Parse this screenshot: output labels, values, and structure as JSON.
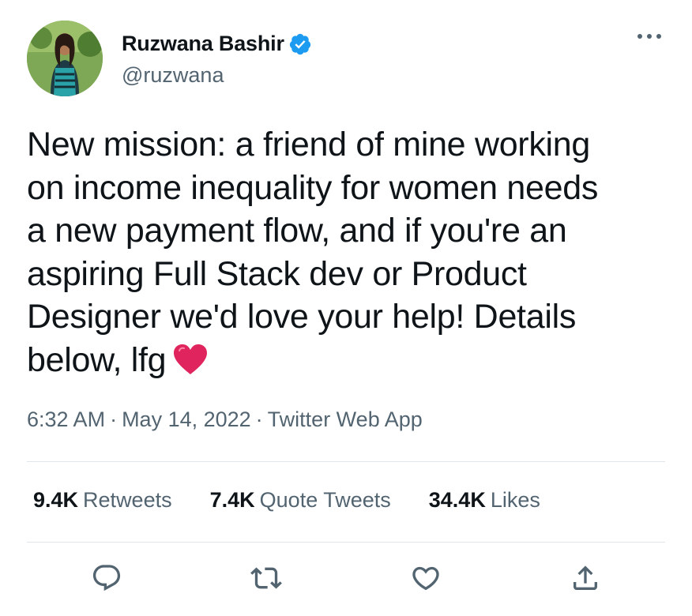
{
  "author": {
    "display_name": "Ruzwana Bashir",
    "handle": "@ruzwana",
    "verified": true
  },
  "tweet": {
    "text": "New mission: a friend of mine working\non income inequality for women needs\na new payment flow, and if you're an\naspiring Full Stack dev or Product\nDesigner we'd love your help! Details\nbelow, lfg",
    "emoji": "red-heart"
  },
  "meta": {
    "time": "6:32 AM",
    "separator": "·",
    "date": "May 14, 2022",
    "source": "Twitter Web App"
  },
  "stats": {
    "retweets": {
      "count": "9.4K",
      "label": "Retweets"
    },
    "quote_tweets": {
      "count": "7.4K",
      "label": "Quote Tweets"
    },
    "likes": {
      "count": "34.4K",
      "label": "Likes"
    }
  },
  "icons": {
    "more": "more-icon",
    "verified": "verified-badge-icon",
    "reply": "reply-icon",
    "retweet": "retweet-icon",
    "like": "like-icon",
    "share": "share-icon"
  },
  "colors": {
    "text_primary": "#0f1419",
    "text_secondary": "#536471",
    "verified_blue": "#1d9bf0",
    "heart_red": "#e0245e",
    "divider": "#e1e6ea"
  }
}
